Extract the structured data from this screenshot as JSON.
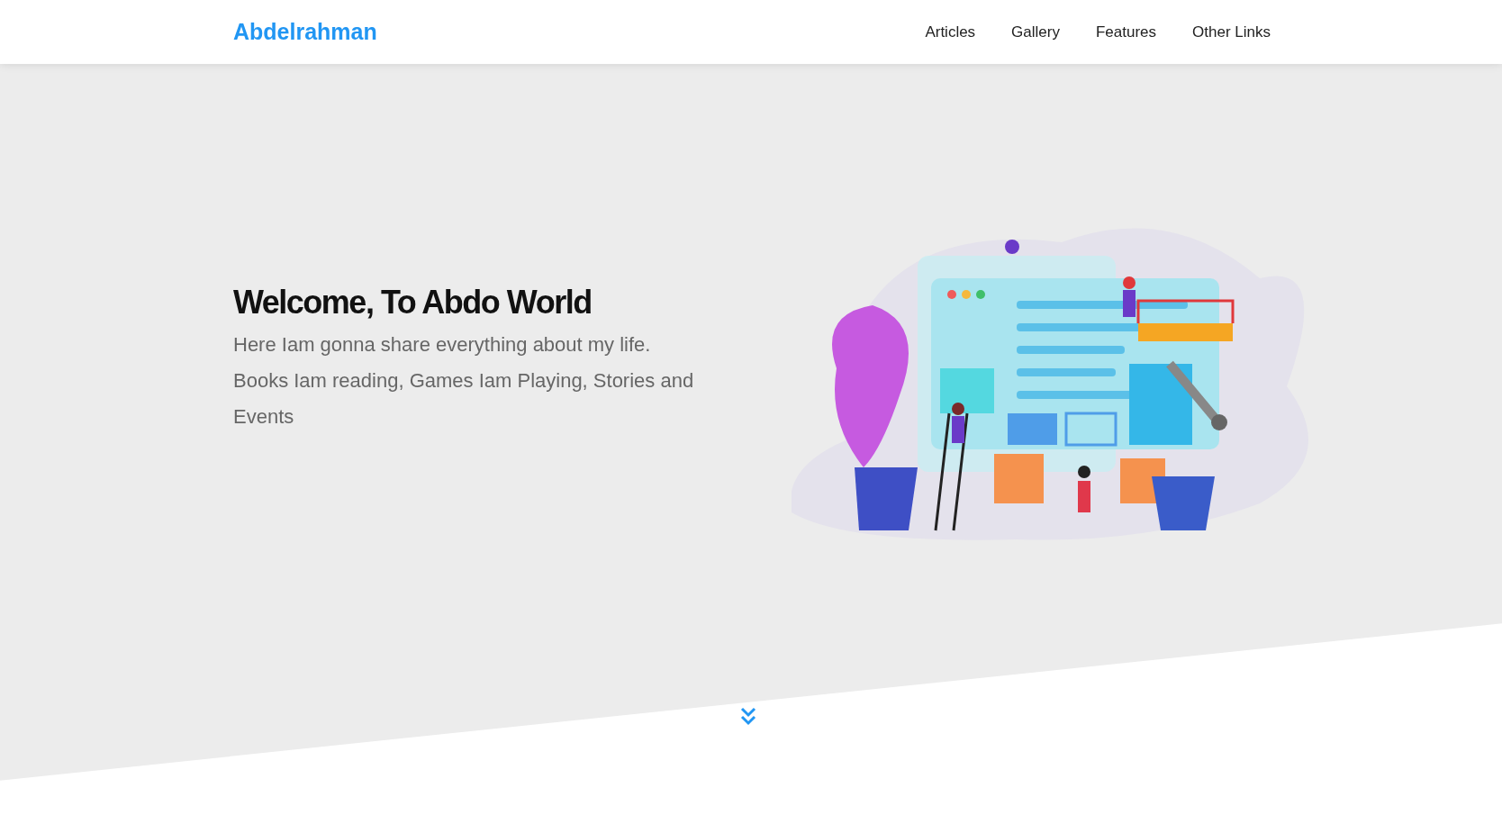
{
  "header": {
    "logo": "Abdelrahman",
    "nav": [
      {
        "label": "Articles"
      },
      {
        "label": "Gallery"
      },
      {
        "label": "Features"
      },
      {
        "label": "Other Links"
      }
    ]
  },
  "hero": {
    "title": "Welcome, To Abdo World",
    "text": "Here Iam gonna share everything about my life. Books Iam reading, Games Iam Playing, Stories and Events"
  }
}
